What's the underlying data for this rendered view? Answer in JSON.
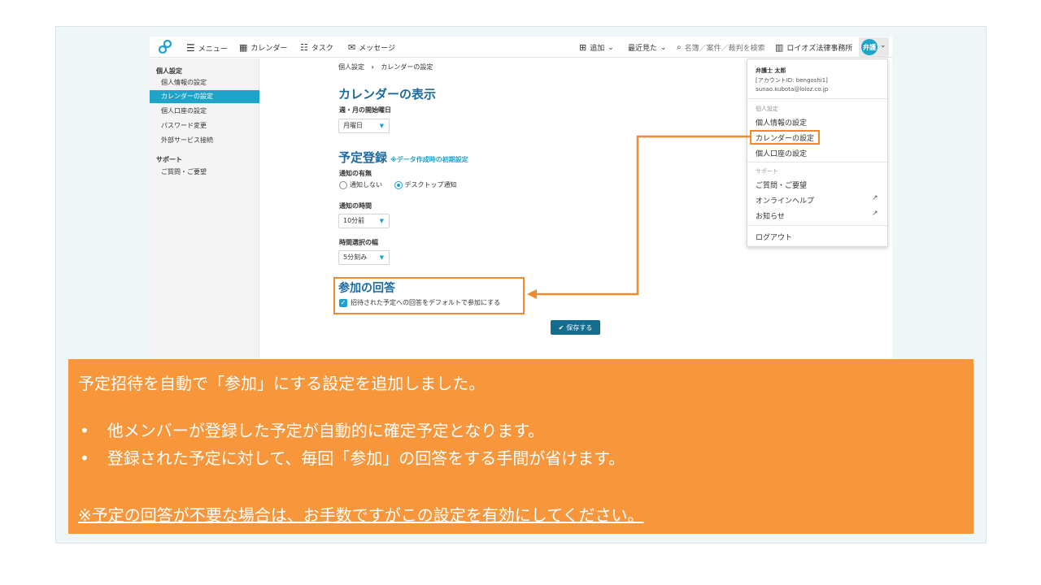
{
  "topbar": {
    "menu": "メニュー",
    "calendar": "カレンダー",
    "task": "タスク",
    "message": "メッセージ",
    "add": "追加",
    "recent": "最近見た",
    "search_placeholder": "名簿／案件／裁判を検索",
    "office": "ロイオズ法律事務所",
    "avatar": "弁護"
  },
  "sidebar": {
    "header_personal": "個人設定",
    "items_personal": [
      "個人情報の設定",
      "カレンダーの設定",
      "個人口座の設定",
      "パスワード変更",
      "外部サービス接続"
    ],
    "header_support": "サポート",
    "items_support": [
      "ご質問・ご要望"
    ]
  },
  "main": {
    "breadcrumb_root": "個人設定",
    "breadcrumb_sep": "›",
    "breadcrumb_current": "カレンダーの設定",
    "section_display": "カレンダーの表示",
    "week_start_label": "週・月の開始曜日",
    "week_start_value": "月曜日",
    "section_schedule": "予定登録",
    "schedule_note": "※データ作成時の初期設定",
    "notify_label": "通知の有無",
    "notify_none": "通知しない",
    "notify_desktop": "デスクトップ通知",
    "notify_time_label": "通知の時間",
    "notify_time_value": "10分前",
    "time_step_label": "時間選択の幅",
    "time_step_value": "5分刻み",
    "section_attend": "参加の回答",
    "attend_checkbox": "招待された予定への回答をデフォルトで参加にする",
    "save": "保存する"
  },
  "menu": {
    "user_name": "弁護士 太郎",
    "account_id": "[アカウントID: bengoshi1]",
    "email": "sunao.kubota@loioz.co.jp",
    "header_personal": "個人設定",
    "personal_info": "個人情報の設定",
    "calendar_settings": "カレンダーの設定",
    "account_settings": "個人口座の設定",
    "header_support": "サポート",
    "faq": "ご質問・ご要望",
    "online_help": "オンラインヘルプ",
    "news": "お知らせ",
    "logout": "ログアウト"
  },
  "callout": {
    "line1": "予定招待を自動で「参加」にする設定を追加しました。",
    "bullet1": "他メンバーが登録した予定が自動的に確定予定となります。",
    "bullet2": "登録された予定に対して、毎回「参加」の回答をする手間が省けます。",
    "bullet_mark": "•",
    "note": "※予定の回答が不要な場合は、お手数ですがこの設定を有効にしてください。"
  },
  "colors": {
    "accent": "#1fa3c9",
    "highlight": "#ef8a2e",
    "callout_bg": "#f7963b"
  }
}
